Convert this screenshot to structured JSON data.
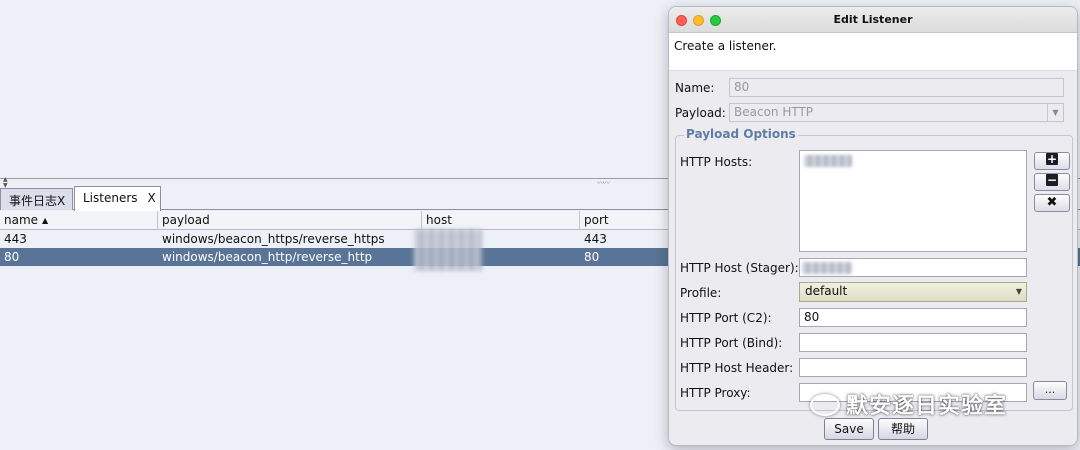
{
  "app": {
    "tabs": [
      {
        "label": "事件日志X"
      },
      {
        "label": "Listeners",
        "close": "X"
      }
    ],
    "table": {
      "columns": [
        "name",
        "payload",
        "host",
        "port"
      ],
      "rows": [
        {
          "name": "443",
          "payload": "windows/beacon_https/reverse_https",
          "port": "443"
        },
        {
          "name": "80",
          "payload": "windows/beacon_http/reverse_http",
          "port": "80"
        }
      ]
    }
  },
  "dialog": {
    "title": "Edit Listener",
    "description": "Create a listener.",
    "name_label": "Name:",
    "name_value": "80",
    "payload_label": "Payload:",
    "payload_value": "Beacon HTTP",
    "group_title": "Payload Options",
    "http_hosts_label": "HTTP Hosts:",
    "http_host_stager_label": "HTTP Host (Stager):",
    "profile_label": "Profile:",
    "profile_value": "default",
    "http_port_c2_label": "HTTP Port (C2):",
    "http_port_c2_value": "80",
    "http_port_bind_label": "HTTP Port (Bind):",
    "http_port_bind_value": "",
    "http_host_header_label": "HTTP Host Header:",
    "http_host_header_value": "",
    "http_proxy_label": "HTTP Proxy:",
    "http_proxy_value": "",
    "ellipsis_label": "...",
    "save_label": "Save",
    "help_label": "帮助"
  },
  "watermark": "默安逐日实验室",
  "colors": {
    "selection": "#5a7497",
    "group_title": "#5e7ea8",
    "background": "#eef0f8"
  }
}
